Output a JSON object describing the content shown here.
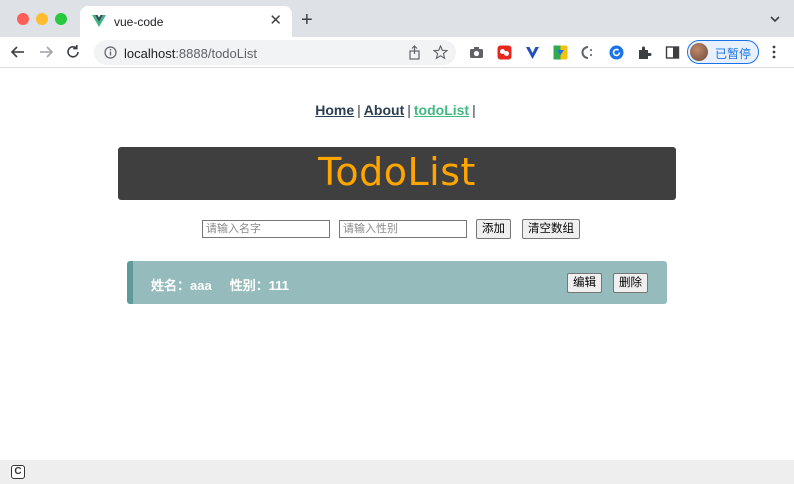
{
  "browser": {
    "tab": {
      "title": "vue-code"
    },
    "address": {
      "host": "localhost",
      "rest": ":8888/todoList"
    },
    "profile": {
      "label": "已暂停"
    }
  },
  "nav": {
    "links": [
      {
        "label": "Home"
      },
      {
        "label": "About"
      },
      {
        "label": "todoList"
      }
    ],
    "separator": "|"
  },
  "banner": {
    "title": "TodoList"
  },
  "form": {
    "name_placeholder": "请输入名字",
    "gender_placeholder": "请输入性别",
    "add_label": "添加",
    "clear_label": "清空数组"
  },
  "todos": [
    {
      "name_label": "姓名：aaa",
      "gender_label": "性别：111",
      "edit_label": "编辑",
      "delete_label": "删除"
    }
  ],
  "colors": {
    "active_link": "#42b983",
    "banner_bg": "#3f3f3f",
    "banner_text": "#ffa500",
    "todo_bg": "#95bbbc",
    "todo_border": "#5e9a9b"
  }
}
